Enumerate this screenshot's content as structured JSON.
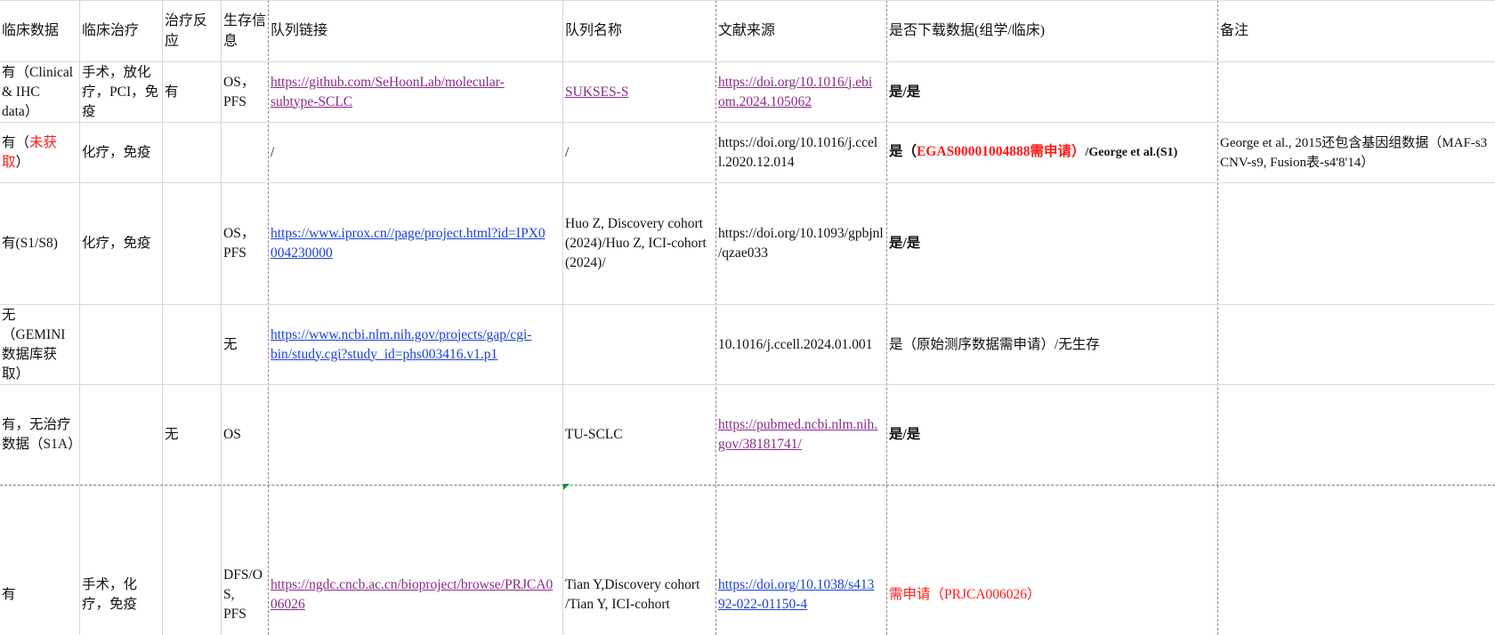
{
  "headers": [
    "临床数据",
    "临床治疗",
    "治疗反\n应",
    "生存信\n息",
    "队列链接",
    "队列名称",
    "文献来源",
    "是否下载数据(组学/临床)",
    "备注"
  ],
  "rows": [
    {
      "clinical": "有（Clinical\n& IHC\ndata）",
      "treatment": "手术，放化\n疗，PCI，免\n疫",
      "response": "有",
      "survival": "OS，\nPFS",
      "link": "https://github.com/SeHoonLab/molecular-\nsubtype-SCLC",
      "name": "SUKSES-S",
      "source": "https://doi.org/10.1016/j.ebi\nom.2024.105062",
      "download": "是/是",
      "note": ""
    },
    {
      "clinical_a": "有（",
      "clinical_b": "未获\n取",
      "clinical_c": "）",
      "treatment": "化疗，免疫",
      "response": "",
      "survival": "",
      "link": "/",
      "name": "/",
      "source": "https://doi.org/10.1016/j.ccel\nl.2020.12.014",
      "download_a": "是（",
      "download_b": "EGAS00001004888需申请）",
      "download_c": "/George et al.(S1)",
      "note": "George et al., 2015还包含基因组数据（MAF-s3\nCNV-s9, Fusion表-s4'8'14）"
    },
    {
      "clinical": "有(S1/S8)",
      "treatment": "化疗，免疫",
      "response": "",
      "survival": "OS，\nPFS",
      "link": "https://www.iprox.cn//page/project.html?id=IPX0\n004230000",
      "name": "Huo Z, Discovery cohort\n(2024)/Huo Z, ICI-cohort\n(2024)/",
      "source": "https://doi.org/10.1093/gpbjnl\n/qzae033",
      "download": "是/是",
      "note": ""
    },
    {
      "clinical": "无\n（GEMINI\n数据库获\n取）",
      "treatment": "",
      "response": "",
      "survival": "无",
      "link": "https://www.ncbi.nlm.nih.gov/projects/gap/cgi-\nbin/study.cgi?study_id=phs003416.v1.p1",
      "name": "",
      "source": "10.1016/j.ccell.2024.01.001",
      "download": "是（原始测序数据需申请）/无生存",
      "note": ""
    },
    {
      "clinical": "有，无治疗\n数据（S1A）",
      "treatment": "",
      "response": "无",
      "survival": "OS",
      "link": "",
      "name": "TU-SCLC",
      "source": "https://pubmed.ncbi.nlm.nih.\ngov/38181741/",
      "download": "是/是",
      "note": ""
    },
    {
      "clinical": "有",
      "treatment": "手术，化\n疗，免疫",
      "response": "",
      "survival": "DFS/O\nS,\nPFS",
      "link": "https://ngdc.cncb.ac.cn/bioproject/browse/PRJCA0\n06026",
      "name": "Tian Y,Discovery cohort\n/Tian Y, ICI-cohort",
      "source": "https://doi.org/10.1038/s413\n92-022-01150-4",
      "download": "需申请（PRJCA006026）",
      "note": ""
    }
  ]
}
